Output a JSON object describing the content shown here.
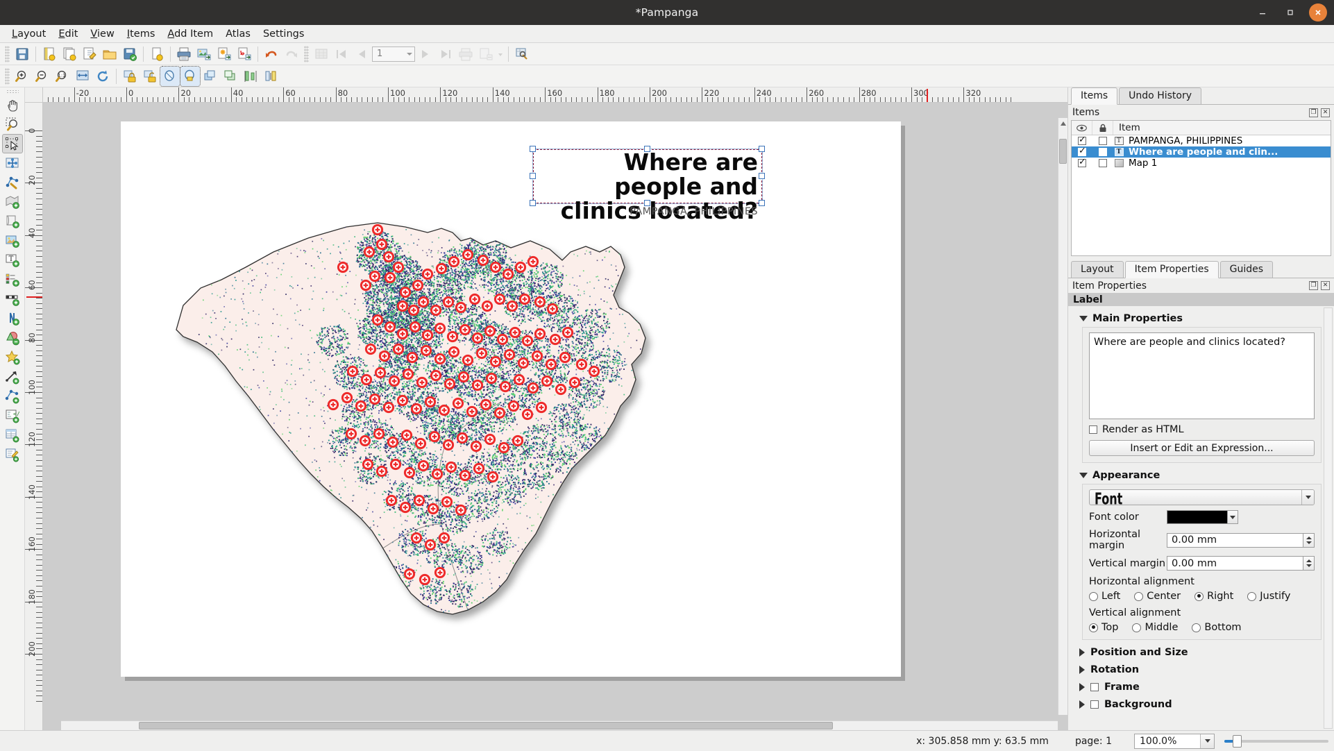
{
  "window": {
    "title": "*Pampanga",
    "minimize_label": "–",
    "maximize_label": "▭",
    "close_label": "✕"
  },
  "menubar": {
    "items": [
      {
        "label": "Layout",
        "mnemonic": "L"
      },
      {
        "label": "Edit",
        "mnemonic": "E"
      },
      {
        "label": "View",
        "mnemonic": "V"
      },
      {
        "label": "Items",
        "mnemonic": "I"
      },
      {
        "label": "Add Item",
        "mnemonic": "A"
      },
      {
        "label": "Atlas",
        "mnemonic": ""
      },
      {
        "label": "Settings",
        "mnemonic": ""
      }
    ]
  },
  "toolbar_main": {
    "buttons": [
      {
        "name": "save-project-icon",
        "tooltip": "Save Project"
      },
      {
        "name": "new-layout-icon",
        "tooltip": "New Layout"
      },
      {
        "name": "duplicate-layout-icon",
        "tooltip": "Duplicate Layout"
      },
      {
        "name": "layout-manager-icon",
        "tooltip": "Layout Manager"
      },
      {
        "name": "open-folder-icon",
        "tooltip": "Open Template"
      },
      {
        "name": "save-template-icon",
        "tooltip": "Save as Template"
      },
      {
        "name": "layout-properties-icon",
        "tooltip": "Layout Properties"
      },
      {
        "name": "print-icon",
        "tooltip": "Print Layout"
      },
      {
        "name": "export-image-icon",
        "tooltip": "Export as Image"
      },
      {
        "name": "export-svg-icon",
        "tooltip": "Export as SVG"
      },
      {
        "name": "export-pdf-icon",
        "tooltip": "Export as PDF"
      },
      {
        "name": "undo-icon",
        "tooltip": "Undo"
      },
      {
        "name": "redo-icon",
        "tooltip": "Redo"
      },
      {
        "name": "atlas-settings-icon",
        "tooltip": "Atlas Settings"
      },
      {
        "name": "atlas-first-feature-icon",
        "tooltip": "First Feature"
      },
      {
        "name": "atlas-prev-feature-icon",
        "tooltip": "Previous Feature"
      },
      {
        "name": "atlas-next-feature-icon",
        "tooltip": "Next Feature"
      },
      {
        "name": "atlas-last-feature-icon",
        "tooltip": "Last Feature"
      },
      {
        "name": "atlas-print-icon",
        "tooltip": "Print Atlas"
      },
      {
        "name": "atlas-export-image-icon",
        "tooltip": "Export Atlas as Images"
      },
      {
        "name": "atlas-preview-icon",
        "tooltip": "Preview Atlas"
      }
    ],
    "atlas_page_value": "1"
  },
  "toolbar_nav": {
    "buttons": [
      {
        "name": "zoom-in-icon",
        "tooltip": "Zoom In"
      },
      {
        "name": "zoom-out-icon",
        "tooltip": "Zoom Out"
      },
      {
        "name": "zoom-full-icon",
        "tooltip": "Zoom Full"
      },
      {
        "name": "zoom-to-width-icon",
        "tooltip": "Zoom to Width"
      },
      {
        "name": "refresh-view-icon",
        "tooltip": "Refresh View"
      },
      {
        "name": "lock-items-icon",
        "tooltip": "Lock Selected Items"
      },
      {
        "name": "unlock-items-icon",
        "tooltip": "Unlock All Items"
      },
      {
        "name": "group-items-icon",
        "tooltip": "Group Items"
      },
      {
        "name": "ungroup-items-icon",
        "tooltip": "Ungroup Items"
      },
      {
        "name": "raise-items-icon",
        "tooltip": "Raise Selected Items"
      },
      {
        "name": "lower-items-icon",
        "tooltip": "Lower Selected Items"
      },
      {
        "name": "align-vertical-icon",
        "tooltip": "Align Items"
      },
      {
        "name": "distribute-icon",
        "tooltip": "Distribute Items"
      }
    ]
  },
  "left_tools": {
    "buttons": [
      {
        "name": "pan-layout-tool",
        "tooltip": "Pan Layout"
      },
      {
        "name": "zoom-tool",
        "tooltip": "Zoom"
      },
      {
        "name": "select-move-item-tool",
        "tooltip": "Select/Move Item",
        "active": true
      },
      {
        "name": "move-item-content-tool",
        "tooltip": "Move Item Content"
      },
      {
        "name": "edit-nodes-tool",
        "tooltip": "Edit Nodes Item"
      },
      {
        "name": "add-map-tool",
        "tooltip": "Add Map"
      },
      {
        "name": "add-picture-tool",
        "tooltip": "Add Picture"
      },
      {
        "name": "add-image-tool",
        "tooltip": "Add Image"
      },
      {
        "name": "add-label-tool",
        "tooltip": "Add Label"
      },
      {
        "name": "add-legend-tool",
        "tooltip": "Add Legend"
      },
      {
        "name": "add-scalebar-tool",
        "tooltip": "Add Scale Bar"
      },
      {
        "name": "add-north-arrow-tool",
        "tooltip": "Add North Arrow"
      },
      {
        "name": "add-shape-tool",
        "tooltip": "Add Shape"
      },
      {
        "name": "add-marker-tool",
        "tooltip": "Add Marker"
      },
      {
        "name": "add-arrow-tool",
        "tooltip": "Add Arrow"
      },
      {
        "name": "add-node-item-tool",
        "tooltip": "Add Node Item"
      },
      {
        "name": "add-html-frame-tool",
        "tooltip": "Add HTML Frame"
      },
      {
        "name": "add-attribute-table-tool",
        "tooltip": "Add Attribute Table"
      },
      {
        "name": "edit-table-tool",
        "tooltip": "Edit Table"
      }
    ]
  },
  "rulers": {
    "horizontal_labels": [
      "-20",
      "0",
      "20",
      "40",
      "60",
      "80",
      "100",
      "120",
      "140",
      "160",
      "180",
      "200",
      "220",
      "240",
      "260",
      "280",
      "300",
      "320"
    ],
    "vertical_labels": [
      "0",
      "20",
      "40",
      "60",
      "80",
      "100",
      "120",
      "140",
      "160",
      "180",
      "200"
    ],
    "units": "mm"
  },
  "layout_canvas": {
    "title_text_line1": "Where are people and",
    "title_text_line2": "clinics located?",
    "subtitle_text": "PAMPANGA, PHILIPPINES",
    "map_item_name": "Map 1"
  },
  "chart_data": {
    "type": "map",
    "title": "Where are people and clinics located?",
    "subtitle": "PAMPANGA, PHILIPPINES",
    "region": "Pampanga, Philippines",
    "layers": [
      {
        "name": "Province boundary",
        "symbol": "polygon",
        "fill": "#fbeeea",
        "stroke": "#3a3a3a"
      },
      {
        "name": "Population density dots",
        "symbol": "points",
        "colors": [
          "#3b2a6b",
          "#2a6f8e",
          "#2fa98b",
          "#5ec96a",
          "#3c3f9e"
        ]
      },
      {
        "name": "Health clinics",
        "symbol": "circle-cross",
        "color": "#ee2b2b",
        "count_visible": 130
      }
    ]
  },
  "right_dock": {
    "top_tabs": [
      {
        "label": "Items",
        "active": true
      },
      {
        "label": "Undo History",
        "active": false
      }
    ],
    "items_dock_title": "Items",
    "items_columns": {
      "visibility": "eye-icon",
      "lock": "lock-icon",
      "item": "Item"
    },
    "items": [
      {
        "label": "PAMPANGA, PHILIPPINES",
        "visible": true,
        "locked": false,
        "type": "label",
        "selected": false
      },
      {
        "label": "Where are people and clin...",
        "visible": true,
        "locked": false,
        "type": "label",
        "selected": true
      },
      {
        "label": "Map 1",
        "visible": true,
        "locked": false,
        "type": "map",
        "selected": false
      }
    ],
    "prop_tabs": [
      {
        "label": "Layout",
        "active": false
      },
      {
        "label": "Item Properties",
        "active": true
      },
      {
        "label": "Guides",
        "active": false
      }
    ],
    "prop_dock_title": "Item Properties",
    "section_title": "Label",
    "main_properties": {
      "header": "Main Properties",
      "text_value": "Where are people and clinics located?",
      "render_as_html_label": "Render as HTML",
      "render_as_html_checked": false,
      "expression_button": "Insert or Edit an Expression..."
    },
    "appearance": {
      "header": "Appearance",
      "font_button_label": "Font",
      "font_color_label": "Font color",
      "font_color_value": "#000000",
      "horizontal_margin_label": "Horizontal margin",
      "horizontal_margin_value": "0.00 mm",
      "vertical_margin_label": "Vertical margin",
      "vertical_margin_value": "0.00 mm",
      "horizontal_alignment_label": "Horizontal alignment",
      "horizontal_alignment_options": [
        "Left",
        "Center",
        "Right",
        "Justify"
      ],
      "horizontal_alignment_selected": "Right",
      "vertical_alignment_label": "Vertical alignment",
      "vertical_alignment_options": [
        "Top",
        "Middle",
        "Bottom"
      ],
      "vertical_alignment_selected": "Top"
    },
    "collapsed_sections": [
      {
        "label": "Position and Size",
        "has_checkbox": false,
        "checked": false
      },
      {
        "label": "Rotation",
        "has_checkbox": false,
        "checked": false
      },
      {
        "label": "Frame",
        "has_checkbox": true,
        "checked": false
      },
      {
        "label": "Background",
        "has_checkbox": true,
        "checked": false
      }
    ]
  },
  "statusbar": {
    "coordinates": "x: 305.858 mm  y: 63.5 mm",
    "page": "page: 1",
    "zoom_value": "100.0%"
  }
}
